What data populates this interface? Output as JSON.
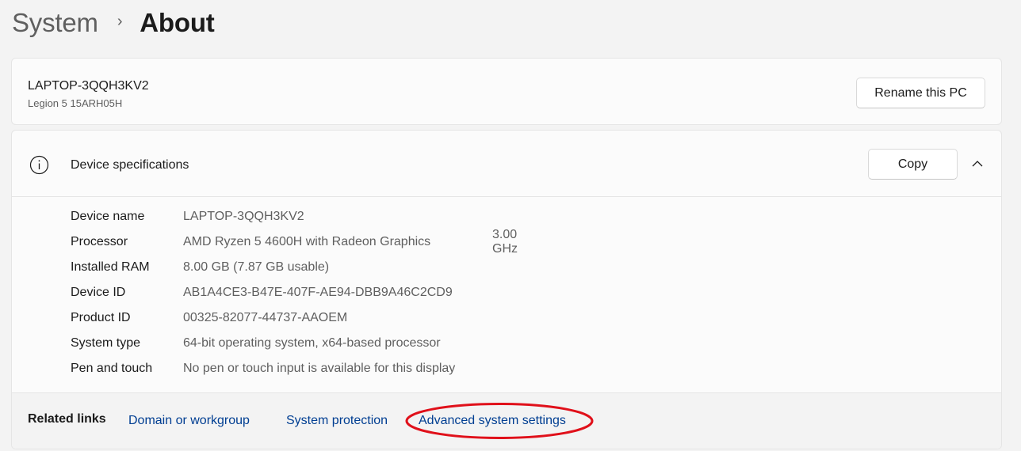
{
  "breadcrumb": {
    "parent": "System",
    "separator": "›",
    "current": "About"
  },
  "pc_card": {
    "name": "LAPTOP-3QQH3KV2",
    "model": "Legion 5 15ARH05H",
    "rename_button": "Rename this PC"
  },
  "device_specs": {
    "title": "Device specifications",
    "copy_button": "Copy",
    "expanded": true,
    "rows": [
      {
        "label": "Device name",
        "value": "LAPTOP-3QQH3KV2"
      },
      {
        "label": "Processor",
        "value": "AMD Ryzen 5 4600H with Radeon Graphics",
        "extra": "3.00 GHz"
      },
      {
        "label": "Installed RAM",
        "value": "8.00 GB (7.87 GB usable)"
      },
      {
        "label": "Device ID",
        "value": "AB1A4CE3-B47E-407F-AE94-DBB9A46C2CD9"
      },
      {
        "label": "Product ID",
        "value": "00325-82077-44737-AAOEM"
      },
      {
        "label": "System type",
        "value": "64-bit operating system, x64-based processor"
      },
      {
        "label": "Pen and touch",
        "value": "No pen or touch input is available for this display"
      }
    ]
  },
  "related_links": {
    "title": "Related links",
    "links": [
      "Domain or workgroup",
      "System protection",
      "Advanced system settings"
    ],
    "highlighted": "Advanced system settings"
  },
  "icons": {
    "info": "info-icon",
    "collapse": "chevron-up-icon"
  },
  "colors": {
    "background": "#f3f3f3",
    "card": "#fbfbfb",
    "link": "#003e92",
    "highlight": "#e0101a"
  }
}
